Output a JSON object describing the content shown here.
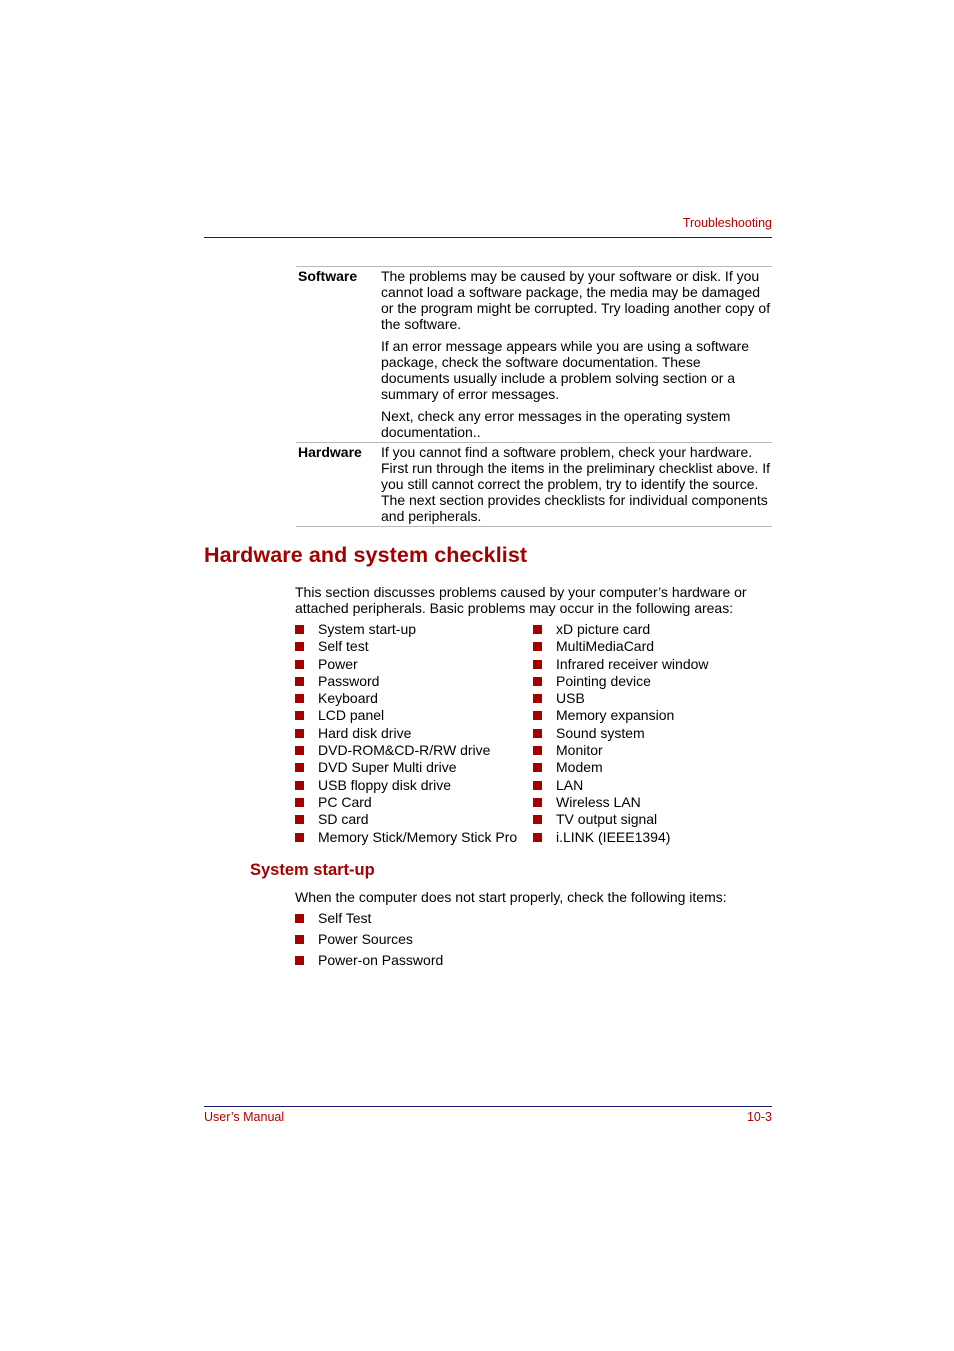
{
  "header": {
    "section_title": "Troubleshooting"
  },
  "table": {
    "rows": [
      {
        "label": "Software",
        "paragraphs": [
          "The problems may be caused by your software or disk. If you cannot load a software package, the media may be damaged or the program might be corrupted. Try loading another copy of the software.",
          "If an error message appears while you are using a software package, check the software documentation. These documents usually include a problem solving section or a summary of error messages.",
          "Next, check any error messages in the operating system documentation.."
        ]
      },
      {
        "label": "Hardware",
        "paragraphs": [
          "If you cannot find a software problem, check your hardware. First run through the items in the preliminary checklist above. If you still cannot correct the problem, try to identify the source. The next section provides checklists for individual components and peripherals."
        ]
      }
    ]
  },
  "checklist": {
    "heading": "Hardware and system checklist",
    "intro": "This section discusses problems caused by your computer’s hardware or attached peripherals. Basic problems may occur in the following areas:",
    "column1": [
      "System start-up",
      "Self test",
      "Power",
      "Password",
      "Keyboard",
      "LCD panel",
      "Hard disk drive",
      "DVD-ROM&CD-R/RW drive",
      "DVD Super Multi drive",
      "USB floppy disk drive",
      "PC Card",
      "SD card",
      "Memory Stick/Memory Stick Pro"
    ],
    "column2": [
      "xD picture card",
      "MultiMediaCard",
      "Infrared receiver window",
      "Pointing device",
      "USB",
      "Memory expansion",
      "Sound system",
      "Monitor",
      "Modem",
      "LAN",
      "Wireless LAN",
      "TV output signal",
      "i.LINK (IEEE1394)"
    ]
  },
  "startup": {
    "heading": "System start-up",
    "intro": "When the computer does not start properly, check the following items:",
    "items": [
      "Self Test",
      "Power Sources",
      "Power-on Password"
    ]
  },
  "footer": {
    "left": "User’s Manual",
    "page": "10-3"
  },
  "colors": {
    "accent": "#a30000",
    "rule": "#1a1a6e"
  }
}
